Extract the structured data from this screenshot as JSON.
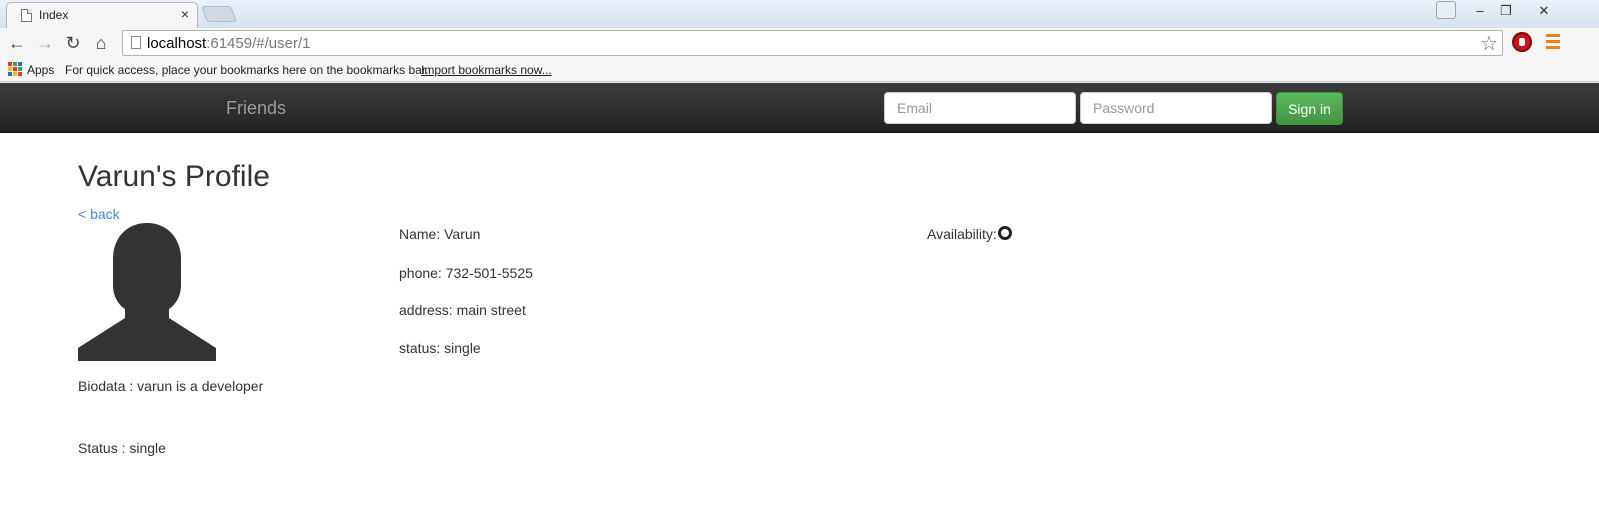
{
  "browser": {
    "tab_title": "Index",
    "tab_close": "×",
    "url_host": "localhost",
    "url_rest": ":61459/#/user/1",
    "bookmarks": {
      "apps_label": "Apps",
      "hint": "For quick access, place your bookmarks here on the bookmarks bar.",
      "import_link": "Import bookmarks now..."
    }
  },
  "navbar": {
    "brand": "Friends",
    "email_placeholder": "Email",
    "password_placeholder": "Password",
    "signin_label": "Sign in"
  },
  "profile": {
    "title": "Varun's Profile",
    "back_label": "< back",
    "biodata": "Biodata : varun is a developer",
    "status_left": "Status : single",
    "name": "Name: Varun",
    "phone": "phone: 732-501-5525",
    "address": "address: main street",
    "status": "status: single",
    "availability_label": "Availability:"
  },
  "colors": {
    "navbar": "#222222",
    "signin_green": "#5cb85c",
    "link_blue": "#428bca",
    "avatar_fill": "#333333"
  }
}
